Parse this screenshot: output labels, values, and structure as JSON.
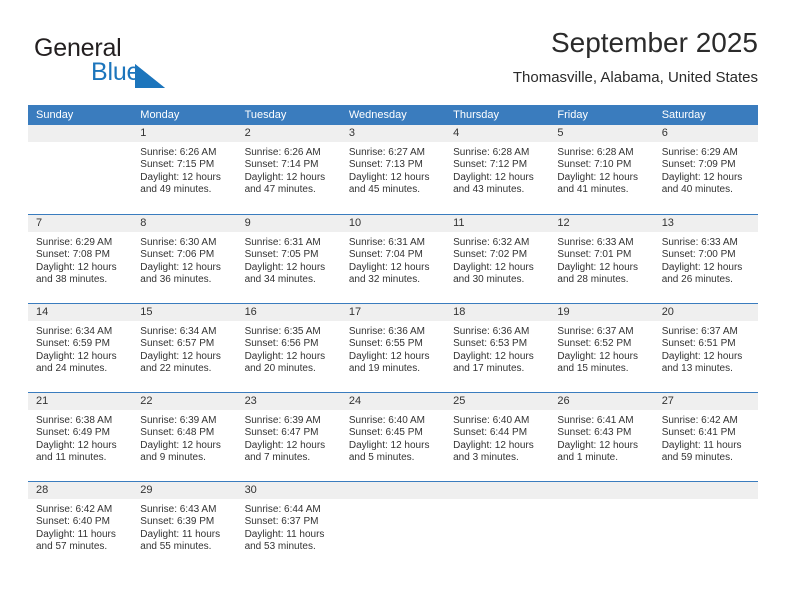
{
  "brand": {
    "word1": "General",
    "word2": "Blue",
    "triangle_color": "#1c75bc",
    "icon": "triangle-logo-icon"
  },
  "header": {
    "title": "September 2025",
    "subtitle": "Thomasville, Alabama, United States"
  },
  "colors": {
    "header_blue": "#3a7cbe",
    "daynum_band": "#efefef",
    "text": "#333333",
    "brand_blue": "#1c75bc"
  },
  "calendar": {
    "weekday_headers": [
      "Sunday",
      "Monday",
      "Tuesday",
      "Wednesday",
      "Thursday",
      "Friday",
      "Saturday"
    ],
    "weeks": [
      [
        {
          "day": "",
          "lines": []
        },
        {
          "day": "1",
          "lines": [
            "Sunrise: 6:26 AM",
            "Sunset: 7:15 PM",
            "Daylight: 12 hours",
            "and 49 minutes."
          ]
        },
        {
          "day": "2",
          "lines": [
            "Sunrise: 6:26 AM",
            "Sunset: 7:14 PM",
            "Daylight: 12 hours",
            "and 47 minutes."
          ]
        },
        {
          "day": "3",
          "lines": [
            "Sunrise: 6:27 AM",
            "Sunset: 7:13 PM",
            "Daylight: 12 hours",
            "and 45 minutes."
          ]
        },
        {
          "day": "4",
          "lines": [
            "Sunrise: 6:28 AM",
            "Sunset: 7:12 PM",
            "Daylight: 12 hours",
            "and 43 minutes."
          ]
        },
        {
          "day": "5",
          "lines": [
            "Sunrise: 6:28 AM",
            "Sunset: 7:10 PM",
            "Daylight: 12 hours",
            "and 41 minutes."
          ]
        },
        {
          "day": "6",
          "lines": [
            "Sunrise: 6:29 AM",
            "Sunset: 7:09 PM",
            "Daylight: 12 hours",
            "and 40 minutes."
          ]
        }
      ],
      [
        {
          "day": "7",
          "lines": [
            "Sunrise: 6:29 AM",
            "Sunset: 7:08 PM",
            "Daylight: 12 hours",
            "and 38 minutes."
          ]
        },
        {
          "day": "8",
          "lines": [
            "Sunrise: 6:30 AM",
            "Sunset: 7:06 PM",
            "Daylight: 12 hours",
            "and 36 minutes."
          ]
        },
        {
          "day": "9",
          "lines": [
            "Sunrise: 6:31 AM",
            "Sunset: 7:05 PM",
            "Daylight: 12 hours",
            "and 34 minutes."
          ]
        },
        {
          "day": "10",
          "lines": [
            "Sunrise: 6:31 AM",
            "Sunset: 7:04 PM",
            "Daylight: 12 hours",
            "and 32 minutes."
          ]
        },
        {
          "day": "11",
          "lines": [
            "Sunrise: 6:32 AM",
            "Sunset: 7:02 PM",
            "Daylight: 12 hours",
            "and 30 minutes."
          ]
        },
        {
          "day": "12",
          "lines": [
            "Sunrise: 6:33 AM",
            "Sunset: 7:01 PM",
            "Daylight: 12 hours",
            "and 28 minutes."
          ]
        },
        {
          "day": "13",
          "lines": [
            "Sunrise: 6:33 AM",
            "Sunset: 7:00 PM",
            "Daylight: 12 hours",
            "and 26 minutes."
          ]
        }
      ],
      [
        {
          "day": "14",
          "lines": [
            "Sunrise: 6:34 AM",
            "Sunset: 6:59 PM",
            "Daylight: 12 hours",
            "and 24 minutes."
          ]
        },
        {
          "day": "15",
          "lines": [
            "Sunrise: 6:34 AM",
            "Sunset: 6:57 PM",
            "Daylight: 12 hours",
            "and 22 minutes."
          ]
        },
        {
          "day": "16",
          "lines": [
            "Sunrise: 6:35 AM",
            "Sunset: 6:56 PM",
            "Daylight: 12 hours",
            "and 20 minutes."
          ]
        },
        {
          "day": "17",
          "lines": [
            "Sunrise: 6:36 AM",
            "Sunset: 6:55 PM",
            "Daylight: 12 hours",
            "and 19 minutes."
          ]
        },
        {
          "day": "18",
          "lines": [
            "Sunrise: 6:36 AM",
            "Sunset: 6:53 PM",
            "Daylight: 12 hours",
            "and 17 minutes."
          ]
        },
        {
          "day": "19",
          "lines": [
            "Sunrise: 6:37 AM",
            "Sunset: 6:52 PM",
            "Daylight: 12 hours",
            "and 15 minutes."
          ]
        },
        {
          "day": "20",
          "lines": [
            "Sunrise: 6:37 AM",
            "Sunset: 6:51 PM",
            "Daylight: 12 hours",
            "and 13 minutes."
          ]
        }
      ],
      [
        {
          "day": "21",
          "lines": [
            "Sunrise: 6:38 AM",
            "Sunset: 6:49 PM",
            "Daylight: 12 hours",
            "and 11 minutes."
          ]
        },
        {
          "day": "22",
          "lines": [
            "Sunrise: 6:39 AM",
            "Sunset: 6:48 PM",
            "Daylight: 12 hours",
            "and 9 minutes."
          ]
        },
        {
          "day": "23",
          "lines": [
            "Sunrise: 6:39 AM",
            "Sunset: 6:47 PM",
            "Daylight: 12 hours",
            "and 7 minutes."
          ]
        },
        {
          "day": "24",
          "lines": [
            "Sunrise: 6:40 AM",
            "Sunset: 6:45 PM",
            "Daylight: 12 hours",
            "and 5 minutes."
          ]
        },
        {
          "day": "25",
          "lines": [
            "Sunrise: 6:40 AM",
            "Sunset: 6:44 PM",
            "Daylight: 12 hours",
            "and 3 minutes."
          ]
        },
        {
          "day": "26",
          "lines": [
            "Sunrise: 6:41 AM",
            "Sunset: 6:43 PM",
            "Daylight: 12 hours",
            "and 1 minute."
          ]
        },
        {
          "day": "27",
          "lines": [
            "Sunrise: 6:42 AM",
            "Sunset: 6:41 PM",
            "Daylight: 11 hours",
            "and 59 minutes."
          ]
        }
      ],
      [
        {
          "day": "28",
          "lines": [
            "Sunrise: 6:42 AM",
            "Sunset: 6:40 PM",
            "Daylight: 11 hours",
            "and 57 minutes."
          ]
        },
        {
          "day": "29",
          "lines": [
            "Sunrise: 6:43 AM",
            "Sunset: 6:39 PM",
            "Daylight: 11 hours",
            "and 55 minutes."
          ]
        },
        {
          "day": "30",
          "lines": [
            "Sunrise: 6:44 AM",
            "Sunset: 6:37 PM",
            "Daylight: 11 hours",
            "and 53 minutes."
          ]
        },
        {
          "day": "",
          "lines": []
        },
        {
          "day": "",
          "lines": []
        },
        {
          "day": "",
          "lines": []
        },
        {
          "day": "",
          "lines": []
        }
      ]
    ]
  }
}
